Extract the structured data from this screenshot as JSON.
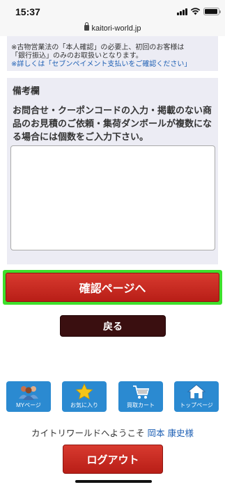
{
  "status_bar": {
    "time": "15:37"
  },
  "browser": {
    "url": "kaitori-world.jp"
  },
  "notice": {
    "line1": "※古物営業法の「本人確認」の必要上、初回のお客様は",
    "line2": "「銀行振込」のみのお取扱いとなります。",
    "link": "※詳しくは「セブンペイメント支払いをご確認ください」"
  },
  "remarks": {
    "heading": "備考欄",
    "description": "お問合せ・クーポンコードの入力・掲載のない商品のお見積のご依頼・集荷ダンボールが複数になる場合には個数をご入力下さい。",
    "value": ""
  },
  "actions": {
    "confirm_label": "確認ページへ",
    "back_label": "戻る",
    "logout_label": "ログアウト"
  },
  "footer_nav": {
    "items": [
      {
        "label": "MYページ",
        "icon": "users-icon"
      },
      {
        "label": "お気に入り",
        "icon": "star-icon"
      },
      {
        "label": "買取カート",
        "icon": "cart-icon"
      },
      {
        "label": "トップページ",
        "icon": "home-icon"
      }
    ]
  },
  "welcome": {
    "text": "カイトリワールドへようこそ",
    "user": "岡本 康史様"
  },
  "colors": {
    "primary_red": "#c52a21",
    "highlight_green": "#3ee02c",
    "nav_blue": "#2b8ad1",
    "back_dark": "#3a0f10",
    "link_blue": "#1d5fb4"
  }
}
